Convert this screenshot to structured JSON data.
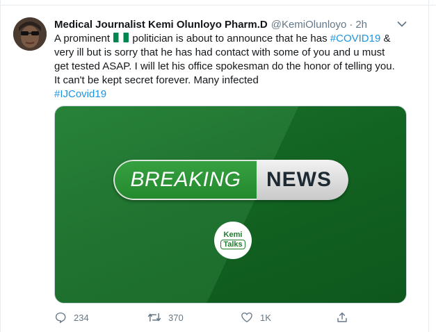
{
  "tweet": {
    "author_name": "Medical Journalist Kemi Olunloyo Pharm.D",
    "handle": "@KemiOlunloyo",
    "separator": "·",
    "time": "2h",
    "text_segments": {
      "s1": "A prominent ",
      "s2": " politician is about to announce that he has ",
      "hashtag_covid": "#COVID19",
      "s3": " & very ill but is sorry that he has had contact with some of you and u must get tested ASAP. I will let his office spokesman do the honor of telling you. It can't be kept secret forever. Many infected",
      "hashtag_ij": "#IJCovid19"
    },
    "flag_emoji": "Nigeria flag",
    "media": {
      "breaking_word": "BREAKING",
      "news_word": "NEWS",
      "logo_top": "Kemi",
      "logo_bottom": "Talks"
    },
    "actions": {
      "reply_count": "234",
      "retweet_count": "370",
      "like_count": "1K"
    }
  },
  "colors": {
    "link": "#1b95e0",
    "muted": "#657786",
    "media_green": "#146c25"
  },
  "icons": [
    "caret-down-icon",
    "reply-icon",
    "retweet-icon",
    "like-icon",
    "share-icon"
  ]
}
